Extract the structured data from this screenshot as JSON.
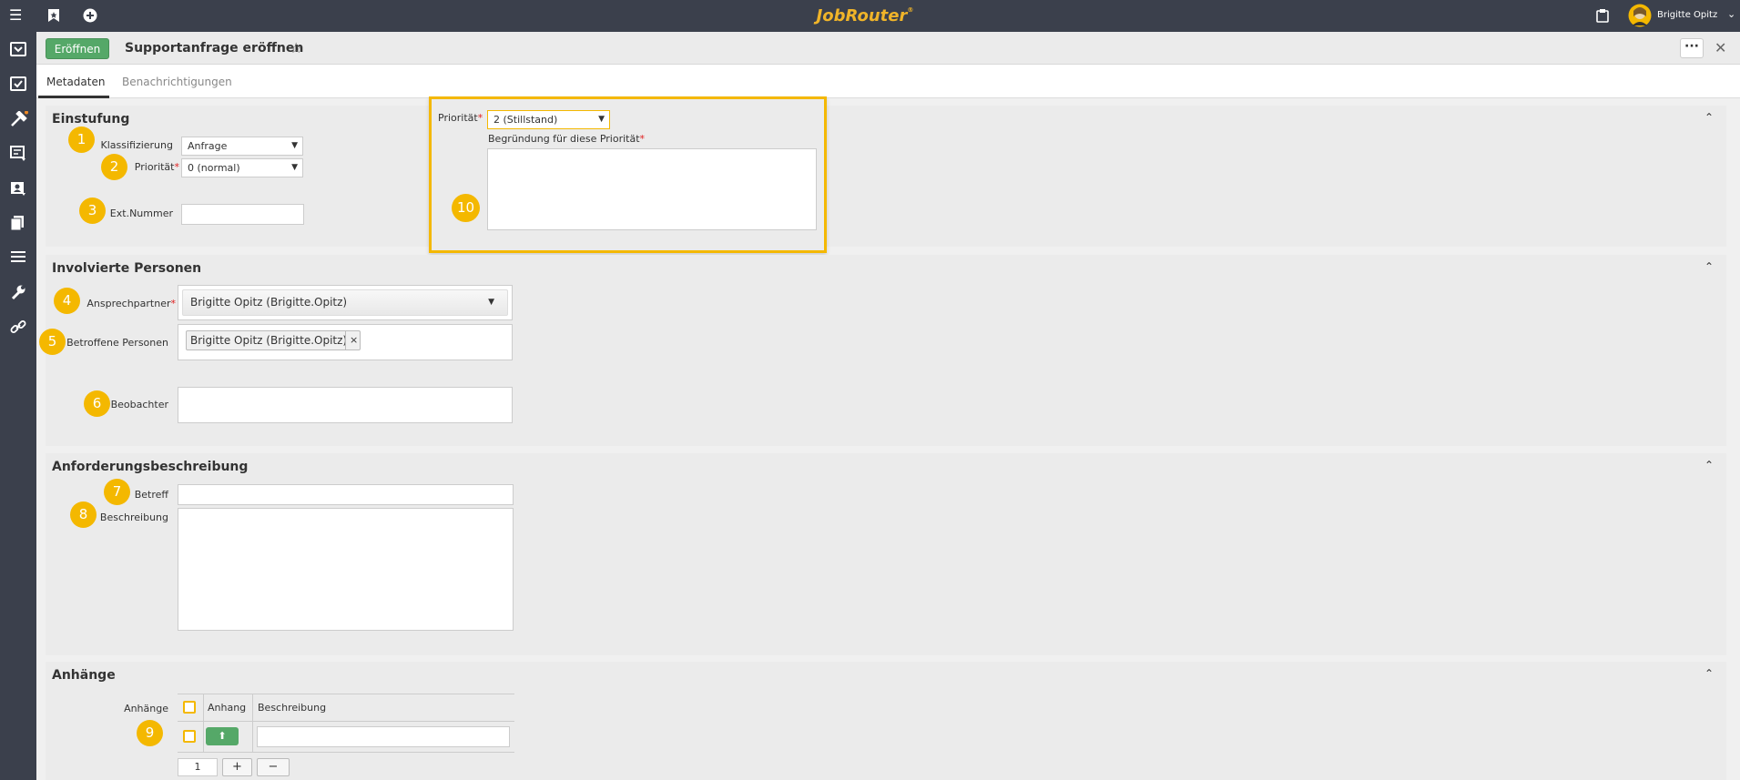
{
  "app": {
    "logo": "JobRouter",
    "logo_mark": "®",
    "user_name": "Brigitte Opitz"
  },
  "toolbar": {
    "open_button": "Eröffnen",
    "title": "Supportanfrage eröffnen",
    "more": "···",
    "close": "✕"
  },
  "tabs": [
    {
      "label": "Metadaten",
      "active": true
    },
    {
      "label": "Benachrichtigungen",
      "active": false
    }
  ],
  "sections": {
    "einstufung": {
      "title": "Einstufung",
      "klassifizierung_label": "Klassifizierung",
      "klassifizierung_value": "Anfrage",
      "prioritaet_label": "Priorität",
      "prioritaet_value": "0 (normal)",
      "ext_nummer_label": "Ext.Nummer",
      "ext_nummer_value": ""
    },
    "highlight": {
      "prioritaet_label": "Priorität",
      "prioritaet_value": "2 (Stillstand)",
      "begruendung_label": "Begründung für diese Priorität",
      "begruendung_value": ""
    },
    "personen": {
      "title": "Involvierte Personen",
      "ansprechpartner_label": "Ansprechpartner",
      "ansprechpartner_value": "Brigitte Opitz (Brigitte.Opitz)",
      "betroffene_label": "Betroffene Personen",
      "betroffene_tags": [
        "Brigitte Opitz (Brigitte.Opitz)"
      ],
      "tag_remove": "×",
      "beobachter_label": "Beobachter"
    },
    "anforderung": {
      "title": "Anforderungsbeschreibung",
      "betreff_label": "Betreff",
      "beschreibung_label": "Beschreibung"
    },
    "anhaenge": {
      "title": "Anhänge",
      "label": "Anhänge",
      "columns": [
        "Anhang",
        "Beschreibung"
      ],
      "page": "1",
      "add": "+",
      "remove": "−"
    }
  },
  "markers": [
    "1",
    "2",
    "3",
    "4",
    "5",
    "6",
    "7",
    "8",
    "9",
    "10"
  ],
  "colors": {
    "accent": "#f4b800",
    "primary_button": "#55a868",
    "topbar": "#3b404c"
  }
}
